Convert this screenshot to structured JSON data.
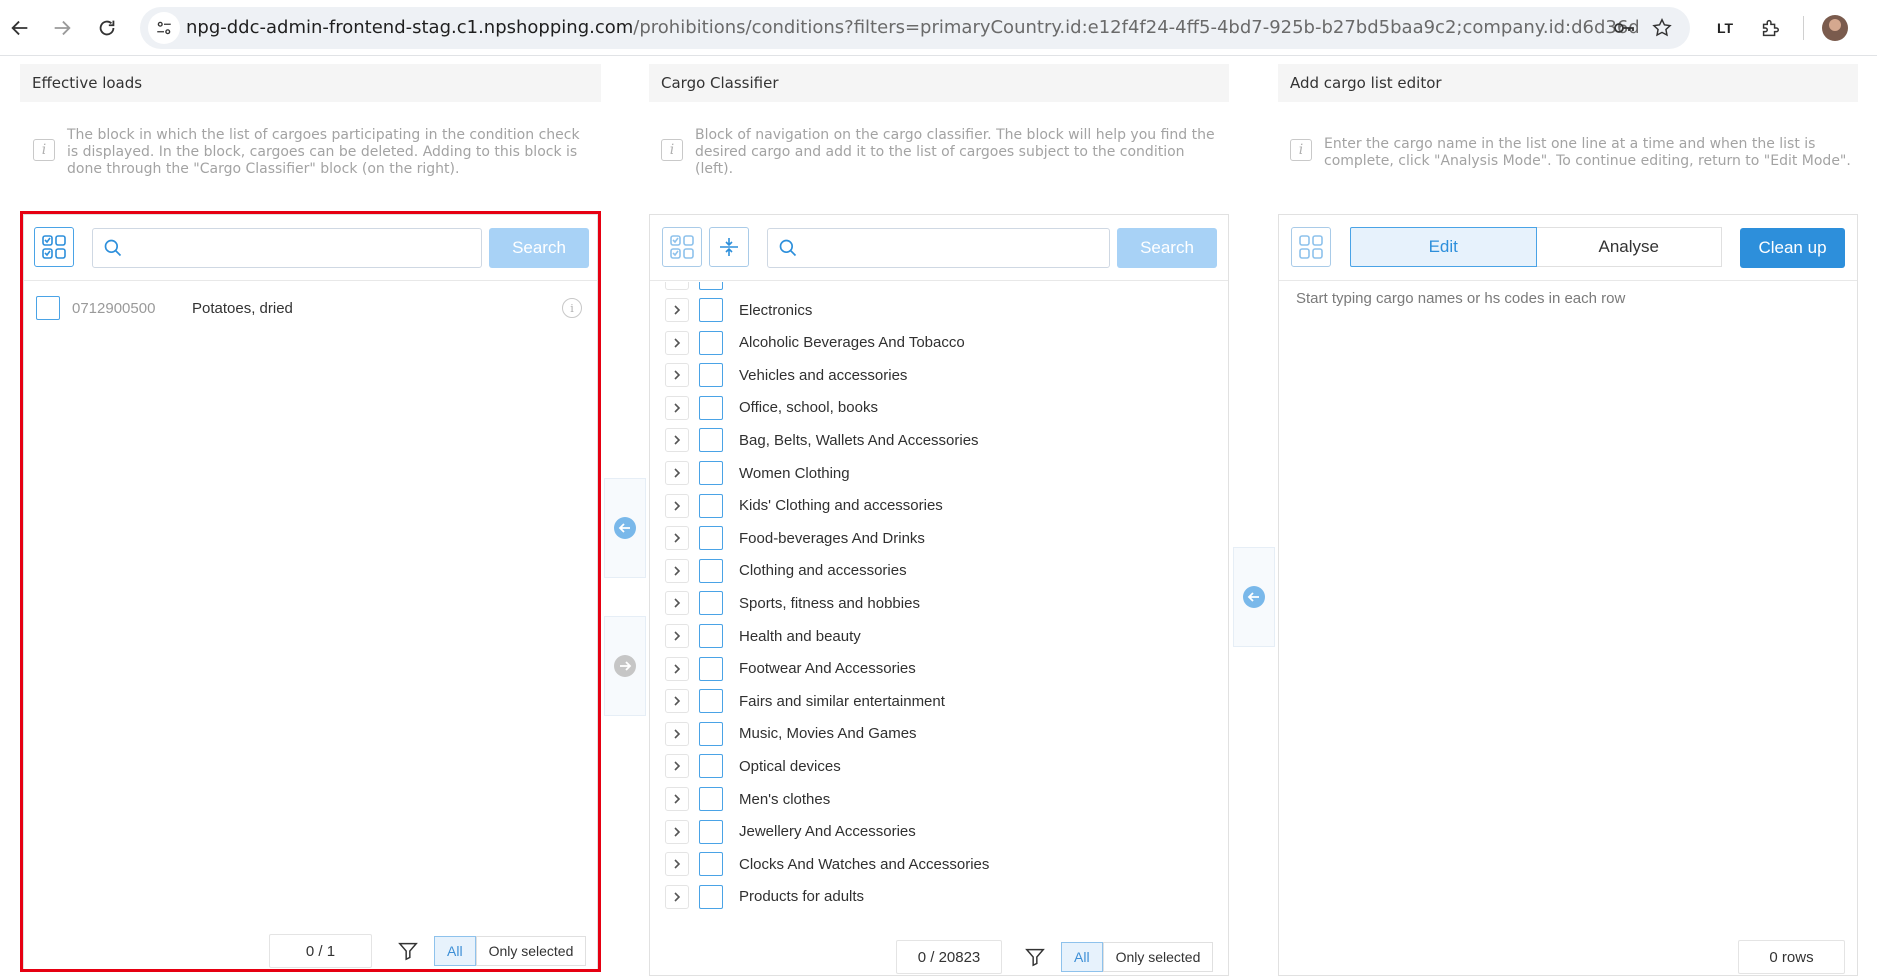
{
  "browser": {
    "url_host": "npg-ddc-admin-frontend-stag.c1.npshopping.com",
    "url_path": "/prohibitions/conditions?filters=primaryCountry.id:e12f4f24-4ff5-4bd7-925b-b27bd5baa9c2;company.id:d6d36d35-7365-4fe5-972...",
    "ext_label": "LT"
  },
  "effective": {
    "title": "Effective loads",
    "info": "The block in which the list of cargoes participating in the condition check is displayed. In the block, cargoes can be deleted. Adding to this block is done through the \"Cargo Classifier\" block (on the right).",
    "search_label": "Search",
    "search_value": "",
    "items": [
      {
        "code": "0712900500",
        "name": "Potatoes, dried"
      }
    ],
    "counter": "0 / 1",
    "filter_all": "All",
    "filter_selected": "Only selected"
  },
  "classifier": {
    "title": "Cargo Classifier",
    "info": "Block of navigation on the cargo classifier. The block will help you find the desired cargo and add it to the list of cargoes subject to the condition (left).",
    "search_label": "Search",
    "search_value": "",
    "items": [
      "Electronics",
      "Alcoholic Beverages And Tobacco",
      "Vehicles and accessories",
      "Office, school, books",
      "Bag, Belts, Wallets And Accessories",
      "Women Clothing",
      "Kids' Clothing and accessories",
      "Food-beverages And Drinks",
      "Clothing and accessories",
      "Sports, fitness and hobbies",
      "Health and beauty",
      "Footwear And Accessories",
      "Fairs and similar entertainment",
      "Music, Movies And Games",
      "Optical devices",
      "Men's clothes",
      "Jewellery And Accessories",
      "Clocks And Watches and Accessories",
      "Products for adults"
    ],
    "counter": "0 / 20823",
    "filter_all": "All",
    "filter_selected": "Only selected"
  },
  "editor": {
    "title": "Add cargo list editor",
    "info": "Enter the cargo name in the list one line at a time and when the list is complete, click \"Analysis Mode\". To continue editing, return to \"Edit Mode\".",
    "tab_edit": "Edit",
    "tab_analyse": "Analyse",
    "cleanup_label": "Clean up",
    "placeholder": "Start typing cargo names or hs codes in each row",
    "rows_counter": "0 rows"
  },
  "colors": {
    "accent": "#2d8fdb",
    "button_disabled": "#a8d2f6",
    "highlight": "#e60012"
  }
}
